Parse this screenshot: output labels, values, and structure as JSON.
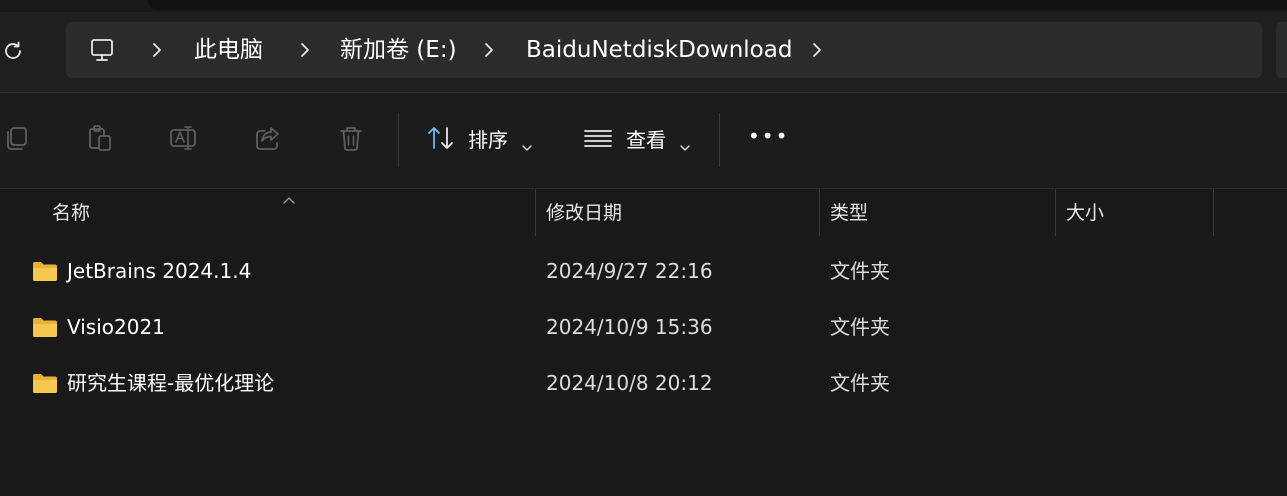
{
  "breadcrumb": {
    "items": [
      "此电脑",
      "新加卷 (E:)",
      "BaiduNetdiskDownload"
    ]
  },
  "toolbar": {
    "sort_label": "排序",
    "view_label": "查看",
    "more_label": "•••"
  },
  "columns": {
    "name": "名称",
    "modified": "修改日期",
    "type": "类型",
    "size": "大小"
  },
  "rows": [
    {
      "name": "JetBrains 2024.1.4",
      "modified": "2024/9/27 22:16",
      "type": "文件夹",
      "size": ""
    },
    {
      "name": "Visio2021",
      "modified": "2024/10/9 15:36",
      "type": "文件夹",
      "size": ""
    },
    {
      "name": "研究生课程-最优化理论",
      "modified": "2024/10/8 20:12",
      "type": "文件夹",
      "size": ""
    }
  ],
  "colors": {
    "background": "#191919",
    "address_box": "#2b2b2b",
    "folder": "#f6c94e",
    "sort_accent": "#6cb8f0"
  }
}
